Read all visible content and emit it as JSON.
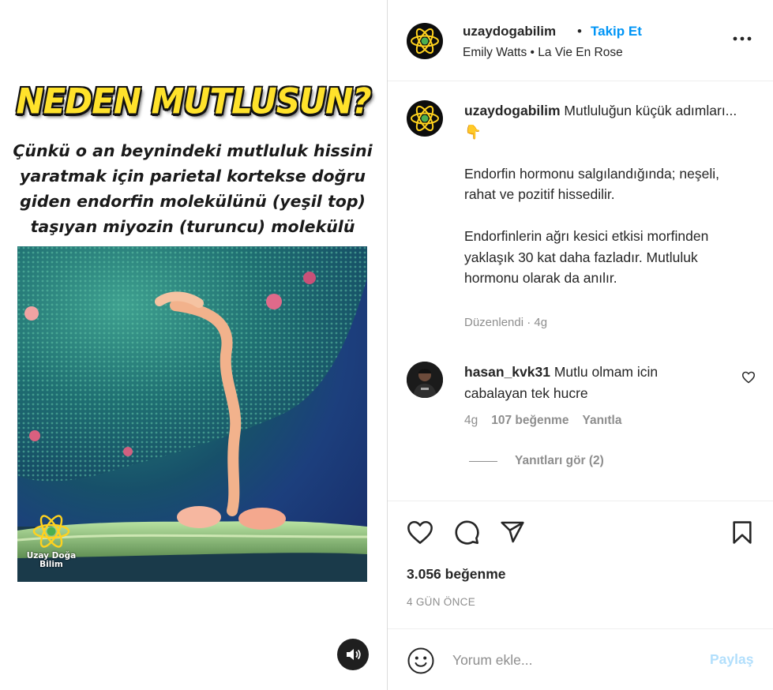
{
  "post": {
    "username": "uzaydogabilim",
    "follow_separator": "•",
    "follow_label": "Takip Et",
    "audio": "Emily Watts • La Vie En Rose"
  },
  "media": {
    "title": "NEDEN MUTLUSUN?",
    "caption": "Çünkü o an beynindeki mutluluk hissini yaratmak için parietal kortekse doğru giden endorfin molekülünü (yeşil top) taşıyan miyozin (turuncu) molekülü var.",
    "watermark_line1": "Uzay Doğa",
    "watermark_line2": "Bilim"
  },
  "caption": {
    "username": "uzaydogabilim",
    "line1": " Mutluluğun küçük adımları... 👇",
    "para2": "Endorfin hormonu salgılandığında; neşeli, rahat ve pozitif hissedilir.",
    "para3": "Endorfinlerin ağrı kesici etkisi morfinden yaklaşık 30 kat daha fazladır. Mutluluk hormonu olarak da anılır.",
    "meta": "Düzenlendi · 4g"
  },
  "comment": {
    "username": "hasan_kvk31",
    "text": " Mutlu olmam icin cabalayan tek hucre",
    "time": "4g",
    "likes": "107 beğenme",
    "reply_label": "Yanıtla",
    "view_replies": "Yanıtları gör (2)"
  },
  "stats": {
    "likes": "3.056 beğenme",
    "date": "4 GÜN ÖNCE"
  },
  "composer": {
    "placeholder": "Yorum ekle...",
    "post_label": "Paylaş"
  },
  "colors": {
    "accent": "#0095f6",
    "post_disabled": "#b2dffc",
    "muted": "#8e8e8e",
    "title_yellow": "#ffe22b"
  },
  "icons": [
    "atom-logo-icon",
    "more-options-icon",
    "heart-icon",
    "comment-icon",
    "share-icon",
    "bookmark-icon",
    "emoji-icon",
    "sound-icon"
  ]
}
